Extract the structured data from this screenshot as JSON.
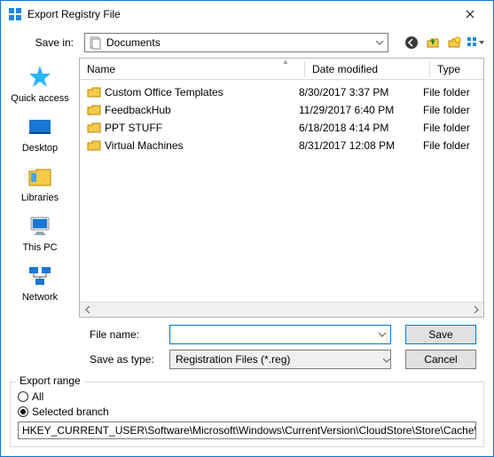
{
  "window": {
    "title": "Export Registry File"
  },
  "lookin": {
    "label": "Save in:",
    "location": "Documents"
  },
  "places": {
    "quick_access": "Quick access",
    "desktop": "Desktop",
    "libraries": "Libraries",
    "this_pc": "This PC",
    "network": "Network"
  },
  "columns": {
    "name": "Name",
    "date": "Date modified",
    "type": "Type"
  },
  "files": [
    {
      "name": "Custom Office Templates",
      "date": "8/30/2017 3:37 PM",
      "type": "File folder"
    },
    {
      "name": "FeedbackHub",
      "date": "11/29/2017 6:40 PM",
      "type": "File folder"
    },
    {
      "name": "PPT STUFF",
      "date": "6/18/2018 4:14 PM",
      "type": "File folder"
    },
    {
      "name": "Virtual Machines",
      "date": "8/31/2017 12:08 PM",
      "type": "File folder"
    }
  ],
  "form": {
    "file_name_label": "File name:",
    "file_name_value": "",
    "save_as_type_label": "Save as type:",
    "save_as_type_value": "Registration Files (*.reg)",
    "save_button": "Save",
    "cancel_button": "Cancel"
  },
  "export_range": {
    "legend": "Export range",
    "all_label": "All",
    "selected_label": "Selected branch",
    "selected": "selected",
    "branch_path": "HKEY_CURRENT_USER\\Software\\Microsoft\\Windows\\CurrentVersion\\CloudStore\\Store\\Cache\\Def"
  }
}
